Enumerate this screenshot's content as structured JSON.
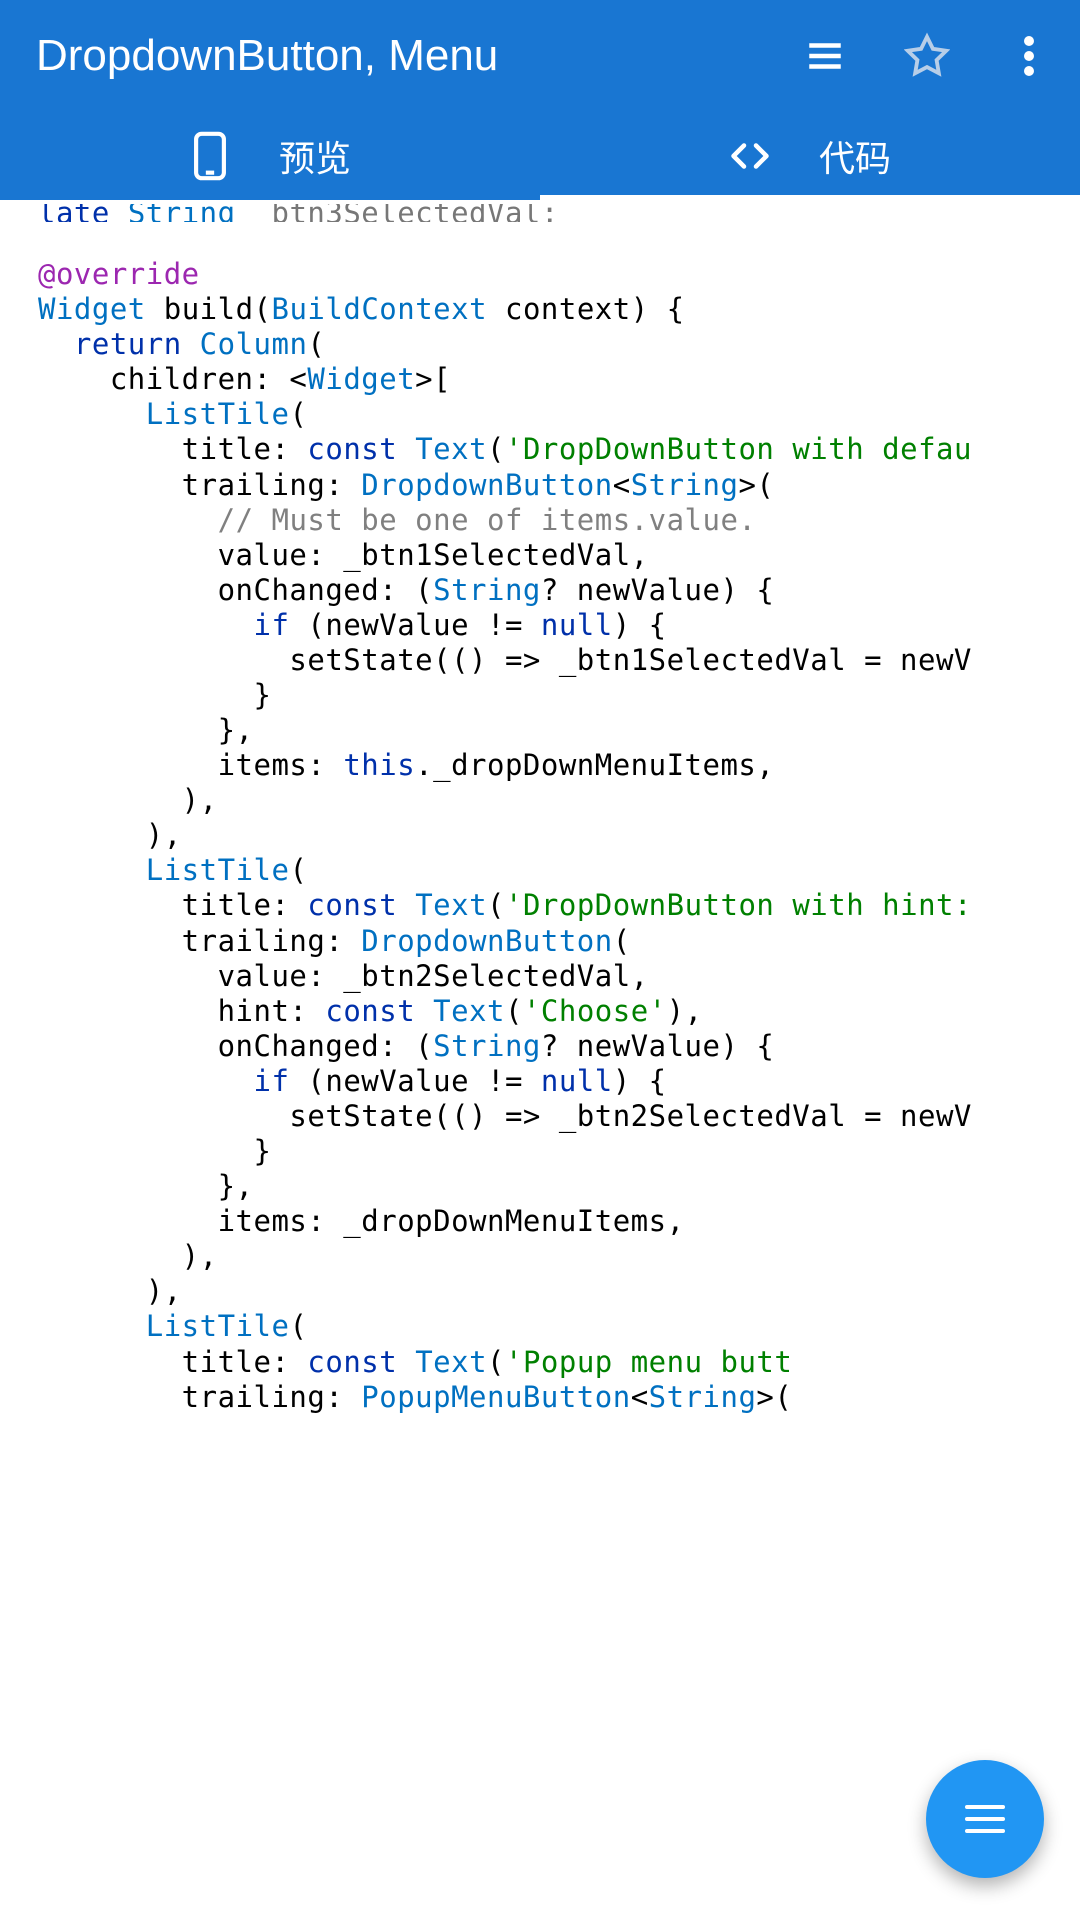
{
  "appbar": {
    "title": "DropdownButton, Menu"
  },
  "tabs": {
    "preview": {
      "label": "预览"
    },
    "code": {
      "label": "代码"
    }
  },
  "code": {
    "truncated_top": "late String _btn3SelectedVal;",
    "tokens": [
      [
        [
          "",
          ""
        ]
      ],
      [
        [
          "ann",
          "@override"
        ]
      ],
      [
        [
          "cls",
          "Widget"
        ],
        [
          "pnc",
          " "
        ],
        [
          "fn",
          "build"
        ],
        [
          "pnc",
          "("
        ],
        [
          "cls",
          "BuildContext"
        ],
        [
          "pnc",
          " context) {"
        ]
      ],
      [
        [
          "pnc",
          "  "
        ],
        [
          "kw",
          "return"
        ],
        [
          "pnc",
          " "
        ],
        [
          "cls",
          "Column"
        ],
        [
          "pnc",
          "("
        ]
      ],
      [
        [
          "pnc",
          "    children: <"
        ],
        [
          "cls",
          "Widget"
        ],
        [
          "pnc",
          ">["
        ]
      ],
      [
        [
          "pnc",
          "      "
        ],
        [
          "cls",
          "ListTile"
        ],
        [
          "pnc",
          "("
        ]
      ],
      [
        [
          "pnc",
          "        title: "
        ],
        [
          "kw",
          "const"
        ],
        [
          "pnc",
          " "
        ],
        [
          "cls",
          "Text"
        ],
        [
          "pnc",
          "("
        ],
        [
          "str",
          "'DropDownButton with defau"
        ]
      ],
      [
        [
          "pnc",
          "        trailing: "
        ],
        [
          "cls",
          "DropdownButton"
        ],
        [
          "pnc",
          "<"
        ],
        [
          "cls",
          "String"
        ],
        [
          "pnc",
          ">("
        ]
      ],
      [
        [
          "pnc",
          "          "
        ],
        [
          "cmt",
          "// Must be one of items.value."
        ]
      ],
      [
        [
          "pnc",
          "          value: _btn1SelectedVal,"
        ]
      ],
      [
        [
          "pnc",
          "          onChanged: ("
        ],
        [
          "cls",
          "String"
        ],
        [
          "pnc",
          "? newValue) {"
        ]
      ],
      [
        [
          "pnc",
          "            "
        ],
        [
          "kw",
          "if"
        ],
        [
          "pnc",
          " (newValue != "
        ],
        [
          "lit",
          "null"
        ],
        [
          "pnc",
          ") {"
        ]
      ],
      [
        [
          "pnc",
          "              setState(() => _btn1SelectedVal = newV"
        ]
      ],
      [
        [
          "pnc",
          "            }"
        ]
      ],
      [
        [
          "pnc",
          "          },"
        ]
      ],
      [
        [
          "pnc",
          "          items: "
        ],
        [
          "kw",
          "this"
        ],
        [
          "pnc",
          "._dropDownMenuItems,"
        ]
      ],
      [
        [
          "pnc",
          "        ),"
        ]
      ],
      [
        [
          "pnc",
          "      ),"
        ]
      ],
      [
        [
          "pnc",
          "      "
        ],
        [
          "cls",
          "ListTile"
        ],
        [
          "pnc",
          "("
        ]
      ],
      [
        [
          "pnc",
          "        title: "
        ],
        [
          "kw",
          "const"
        ],
        [
          "pnc",
          " "
        ],
        [
          "cls",
          "Text"
        ],
        [
          "pnc",
          "("
        ],
        [
          "str",
          "'DropDownButton with hint:"
        ]
      ],
      [
        [
          "pnc",
          "        trailing: "
        ],
        [
          "cls",
          "DropdownButton"
        ],
        [
          "pnc",
          "("
        ]
      ],
      [
        [
          "pnc",
          "          value: _btn2SelectedVal,"
        ]
      ],
      [
        [
          "pnc",
          "          hint: "
        ],
        [
          "kw",
          "const"
        ],
        [
          "pnc",
          " "
        ],
        [
          "cls",
          "Text"
        ],
        [
          "pnc",
          "("
        ],
        [
          "str",
          "'Choose'"
        ],
        [
          "pnc",
          "),"
        ]
      ],
      [
        [
          "pnc",
          "          onChanged: ("
        ],
        [
          "cls",
          "String"
        ],
        [
          "pnc",
          "? newValue) {"
        ]
      ],
      [
        [
          "pnc",
          "            "
        ],
        [
          "kw",
          "if"
        ],
        [
          "pnc",
          " (newValue != "
        ],
        [
          "lit",
          "null"
        ],
        [
          "pnc",
          ") {"
        ]
      ],
      [
        [
          "pnc",
          "              setState(() => _btn2SelectedVal = newV"
        ]
      ],
      [
        [
          "pnc",
          "            }"
        ]
      ],
      [
        [
          "pnc",
          "          },"
        ]
      ],
      [
        [
          "pnc",
          "          items: _dropDownMenuItems,"
        ]
      ],
      [
        [
          "pnc",
          "        ),"
        ]
      ],
      [
        [
          "pnc",
          "      ),"
        ]
      ],
      [
        [
          "pnc",
          "      "
        ],
        [
          "cls",
          "ListTile"
        ],
        [
          "pnc",
          "("
        ]
      ],
      [
        [
          "pnc",
          "        title: "
        ],
        [
          "kw",
          "const"
        ],
        [
          "pnc",
          " "
        ],
        [
          "cls",
          "Text"
        ],
        [
          "pnc",
          "("
        ],
        [
          "str",
          "'Popup menu butt"
        ]
      ],
      [
        [
          "pnc",
          "        trailing: "
        ],
        [
          "cls",
          "PopupMenuButton"
        ],
        [
          "pnc",
          "<"
        ],
        [
          "cls",
          "String"
        ],
        [
          "pnc",
          ">("
        ]
      ]
    ]
  }
}
